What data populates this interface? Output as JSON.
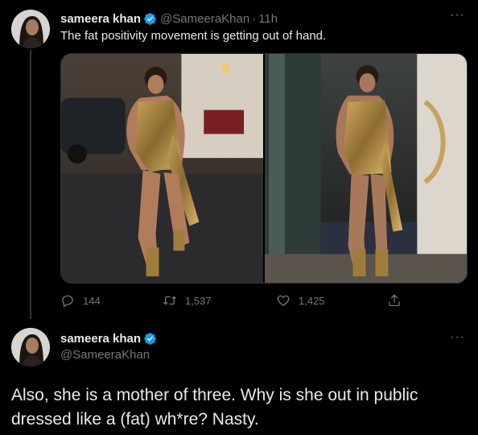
{
  "tweet1": {
    "author_name": "sameera khan",
    "handle": "@SameeraKhan",
    "separator": "·",
    "time": "11h",
    "more_icon": "more-dots-icon",
    "more_label": "···",
    "text": "The fat positivity movement is getting out of hand.",
    "actions": {
      "reply_count": "144",
      "retweet_count": "1,537",
      "like_count": "1,425"
    }
  },
  "tweet2": {
    "author_name": "sameera khan",
    "handle": "@SameeraKhan",
    "more_label": "···",
    "text": "Also, she is a mother of three. Why is she out in public dressed like a (fat) wh*re? Nasty."
  },
  "colors": {
    "background": "#000000",
    "text_primary": "#e7e9ea",
    "text_secondary": "#71767b",
    "verified_blue": "#1d9bf0",
    "divider": "#2f3336"
  }
}
